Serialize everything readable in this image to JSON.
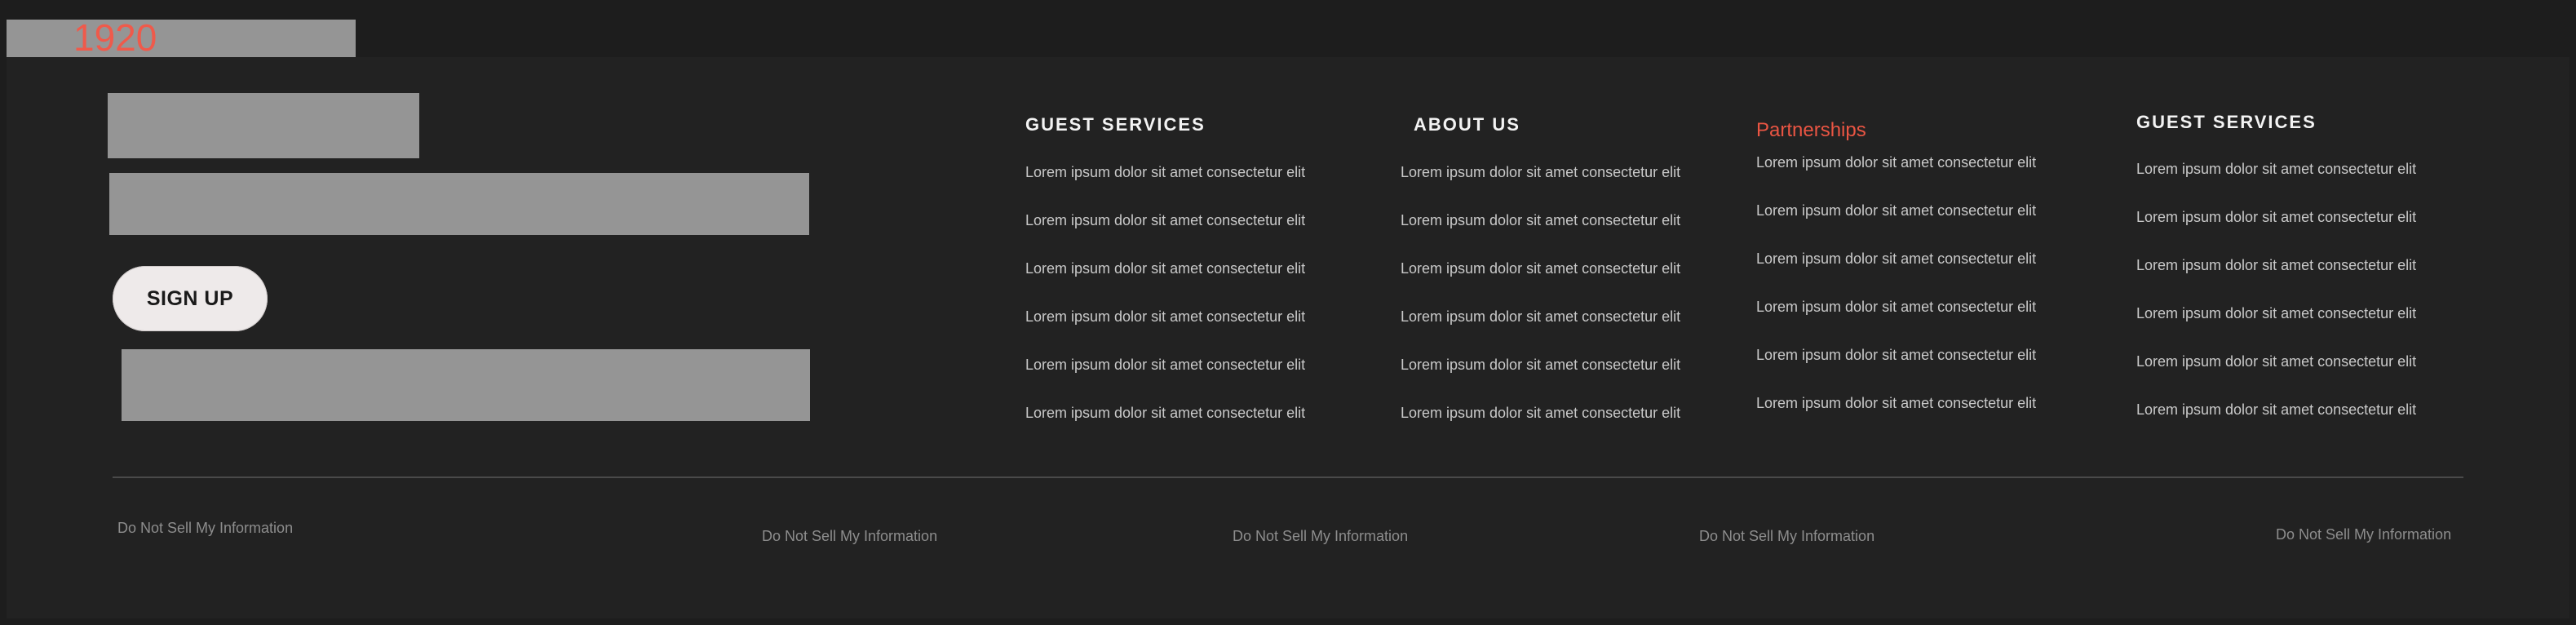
{
  "top_label": {
    "text": "1920"
  },
  "signup": {
    "label": "SIGN UP"
  },
  "columns": [
    {
      "title": "GUEST SERVICES",
      "title_color": "#f3f3f3",
      "links": [
        "Lorem ipsum dolor sit amet consectetur elit",
        "Lorem ipsum dolor sit amet consectetur elit",
        "Lorem ipsum dolor sit amet consectetur elit",
        "Lorem ipsum dolor sit amet consectetur elit",
        "Lorem ipsum dolor sit amet consectetur elit",
        "Lorem ipsum dolor sit amet consectetur elit"
      ]
    },
    {
      "title": "ABOUT US",
      "title_color": "#f3f3f3",
      "links": [
        "Lorem ipsum dolor sit amet consectetur elit",
        "Lorem ipsum dolor sit amet consectetur elit",
        "Lorem ipsum dolor sit amet consectetur elit",
        "Lorem ipsum dolor sit amet consectetur elit",
        "Lorem ipsum dolor sit amet consectetur elit",
        "Lorem ipsum dolor sit amet consectetur elit"
      ]
    },
    {
      "title": "Partnerships",
      "title_color": "#ea5543",
      "links": [
        "Lorem ipsum dolor sit amet consectetur elit",
        "Lorem ipsum dolor sit amet consectetur elit",
        "Lorem ipsum dolor sit amet consectetur elit",
        "Lorem ipsum dolor sit amet consectetur elit",
        "Lorem ipsum dolor sit amet consectetur elit",
        "Lorem ipsum dolor sit amet consectetur elit"
      ]
    },
    {
      "title": "GUEST SERVICES",
      "title_color": "#f3f3f3",
      "links": [
        "Lorem ipsum dolor sit amet consectetur elit",
        "Lorem ipsum dolor sit amet consectetur elit",
        "Lorem ipsum dolor sit amet consectetur elit",
        "Lorem ipsum dolor sit amet consectetur elit",
        "Lorem ipsum dolor sit amet consectetur elit",
        "Lorem ipsum dolor sit amet consectetur elit"
      ]
    }
  ],
  "bottom_links": [
    "Do Not Sell My Information",
    "Do Not Sell My Information",
    "Do Not Sell My Information",
    "Do Not Sell My Information",
    "Do Not Sell My Information"
  ]
}
